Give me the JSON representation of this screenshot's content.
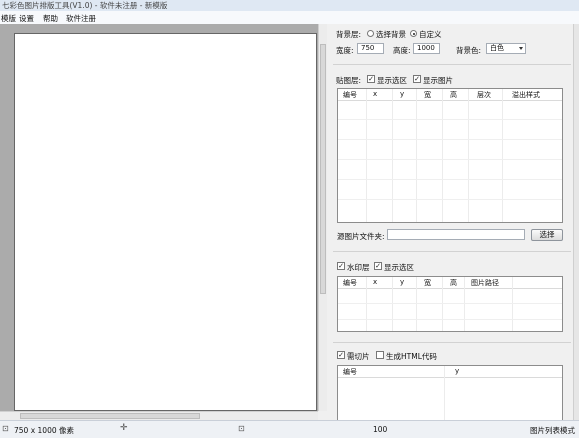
{
  "window": {
    "title": "七彩色图片排版工具(V1.0) - 软件未注册 - 新模版"
  },
  "menu": {
    "items": [
      "模版",
      "设置",
      "帮助",
      "软件注册"
    ]
  },
  "background": {
    "label": "背景层:",
    "option_select": "选择背景",
    "option_custom": "自定义",
    "selected": "自定义",
    "width_label": "宽度:",
    "width_value": "750",
    "height_label": "高度:",
    "height_value": "1000",
    "color_label": "背景色:",
    "color_value": "白色"
  },
  "paste_layer": {
    "label": "贴图层:",
    "show_selection": "显示选区",
    "show_images": "显示图片",
    "show_selection_checked": true,
    "show_images_checked": true,
    "columns": [
      "编号",
      "x",
      "y",
      "宽",
      "高",
      "层次",
      "溢出样式"
    ]
  },
  "source_folder": {
    "label": "源图片文件夹:",
    "value": "",
    "button": "选择"
  },
  "watermark": {
    "label": "水印层",
    "label_checked": true,
    "show_selection": "显示选区",
    "show_selection_checked": true,
    "columns": [
      "编号",
      "x",
      "y",
      "宽",
      "高",
      "图片路径"
    ]
  },
  "slicing": {
    "label": "需切片",
    "label_checked": true,
    "html": "生成HTML代码",
    "html_checked": false,
    "columns": [
      "编号",
      "y"
    ]
  },
  "status": {
    "size": "750 x 1000 像素",
    "zoom": "100",
    "mode": "图片列表模式"
  }
}
